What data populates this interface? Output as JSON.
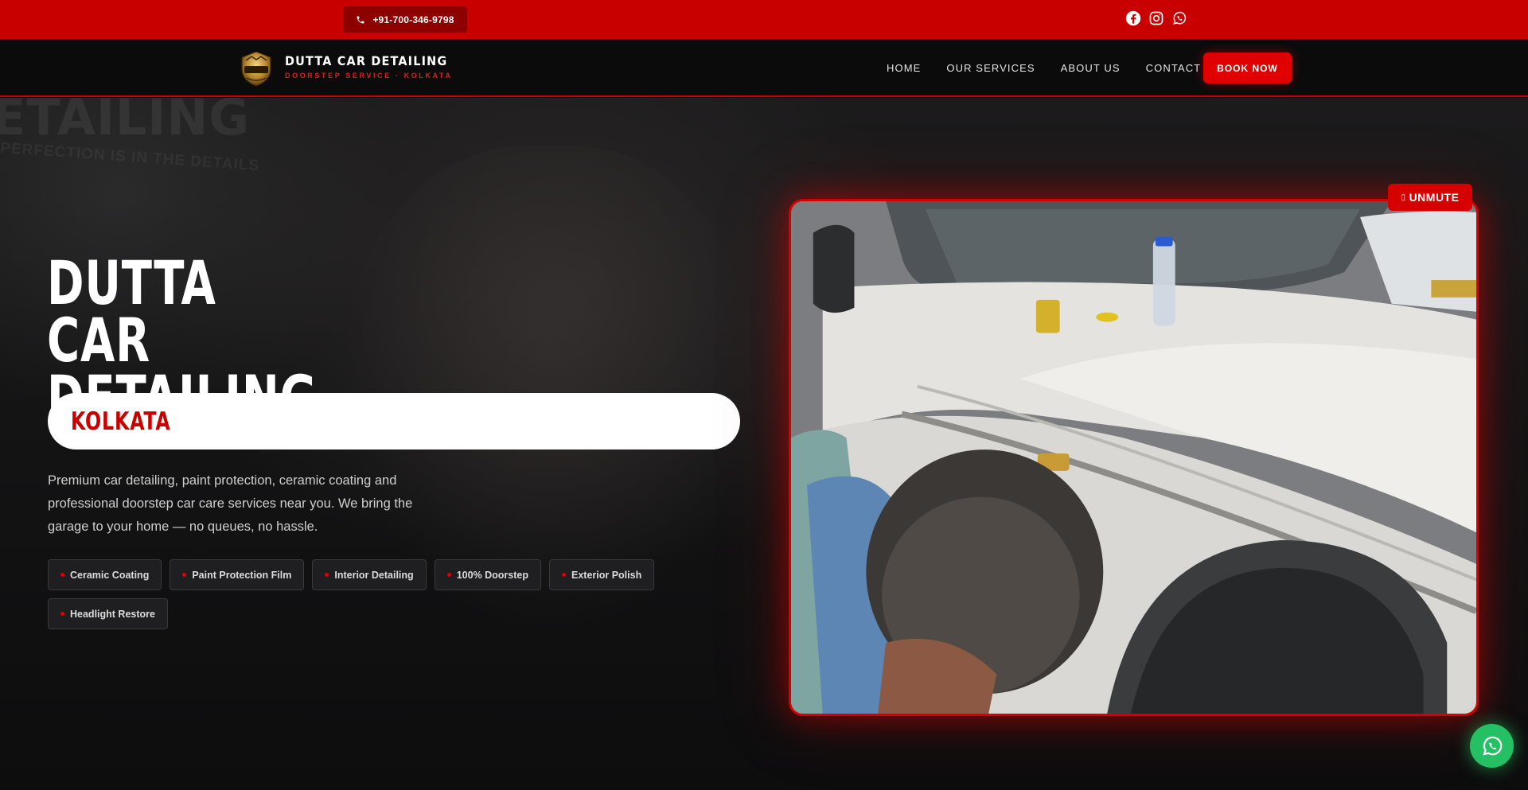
{
  "topbar": {
    "phone": "+91-700-346-9798",
    "socials": [
      "facebook-icon",
      "instagram-icon",
      "whatsapp-icon"
    ]
  },
  "header": {
    "brand_title": "DUTTA CAR DETAILING",
    "brand_subtitle": "DOORSTEP SERVICE · KOLKATA",
    "nav": [
      "HOME",
      "OUR SERVICES",
      "ABOUT US",
      "CONTACT US"
    ],
    "cta": "BOOK NOW"
  },
  "hero": {
    "bg_word": "ETAILING",
    "bg_tagline": "PERFECTION IS IN THE DETAILS",
    "title_line1": "DUTTA CAR",
    "title_line2": "DETAILING",
    "city": "KOLKATA",
    "description": "Premium car detailing, paint protection, ceramic coating and professional doorstep car care services near you. We bring the garage to your home — no queues, no hassle.",
    "chips": [
      "Ceramic Coating",
      "Paint Protection Film",
      "Interior Detailing",
      "100% Doorstep",
      "Exterior Polish",
      "Headlight Restore"
    ]
  },
  "video": {
    "unmute_label": "UNMUTE",
    "unmute_icon": "speaker-muted-icon"
  },
  "colors": {
    "brand_red": "#c80000",
    "accent_red": "#e00000",
    "whatsapp_green": "#25c063",
    "dark_bg": "#0c0c0d"
  }
}
